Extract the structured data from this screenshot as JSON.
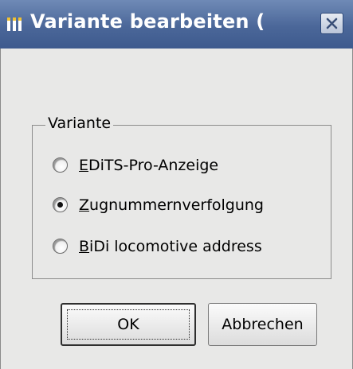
{
  "window": {
    "title": "Variante bearbeiten (",
    "app_icon": "app-logo-icon",
    "close_icon": "close-icon"
  },
  "group": {
    "label": "Variante"
  },
  "options": [
    {
      "mnemonic": "E",
      "rest": "DiTS-Pro-Anzeige",
      "checked": false
    },
    {
      "mnemonic": "Z",
      "rest": "ugnummernverfolgung",
      "checked": true
    },
    {
      "mnemonic": "B",
      "rest": "iDi locomotive address",
      "checked": false
    }
  ],
  "buttons": {
    "ok_label": "OK",
    "cancel_label": "Abbrechen"
  },
  "colors": {
    "titlebar": "#4b6799",
    "background": "#e8e8e7"
  }
}
